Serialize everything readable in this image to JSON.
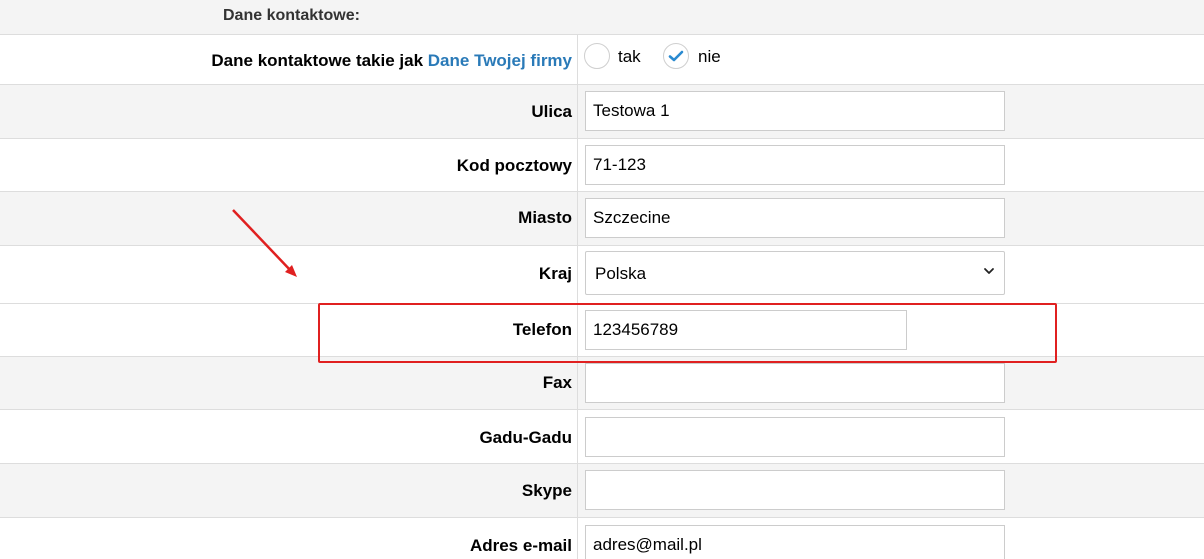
{
  "section": {
    "title": "Dane kontaktowe:"
  },
  "contact_same": {
    "label_prefix": "Dane kontaktowe takie jak",
    "label_link": "Dane Twojej firmy",
    "option_yes": "tak",
    "option_no": "nie",
    "selected": "nie"
  },
  "fields": {
    "street": {
      "label": "Ulica",
      "value": "Testowa 1"
    },
    "postal": {
      "label": "Kod pocztowy",
      "value": "71-123"
    },
    "city": {
      "label": "Miasto",
      "value": "Szczecine"
    },
    "country": {
      "label": "Kraj",
      "value": "Polska"
    },
    "phone": {
      "label": "Telefon",
      "value": "123456789"
    },
    "fax": {
      "label": "Fax",
      "value": ""
    },
    "gadu": {
      "label": "Gadu-Gadu",
      "value": ""
    },
    "skype": {
      "label": "Skype",
      "value": ""
    },
    "email": {
      "label": "Adres e-mail",
      "value": "adres@mail.pl"
    }
  },
  "colors": {
    "annotation": "#e02020",
    "link": "#2a7ab8",
    "check": "#2a8ad0"
  },
  "icons": {
    "dropdown": "chevron-down-icon",
    "check": "checkmark-icon"
  }
}
